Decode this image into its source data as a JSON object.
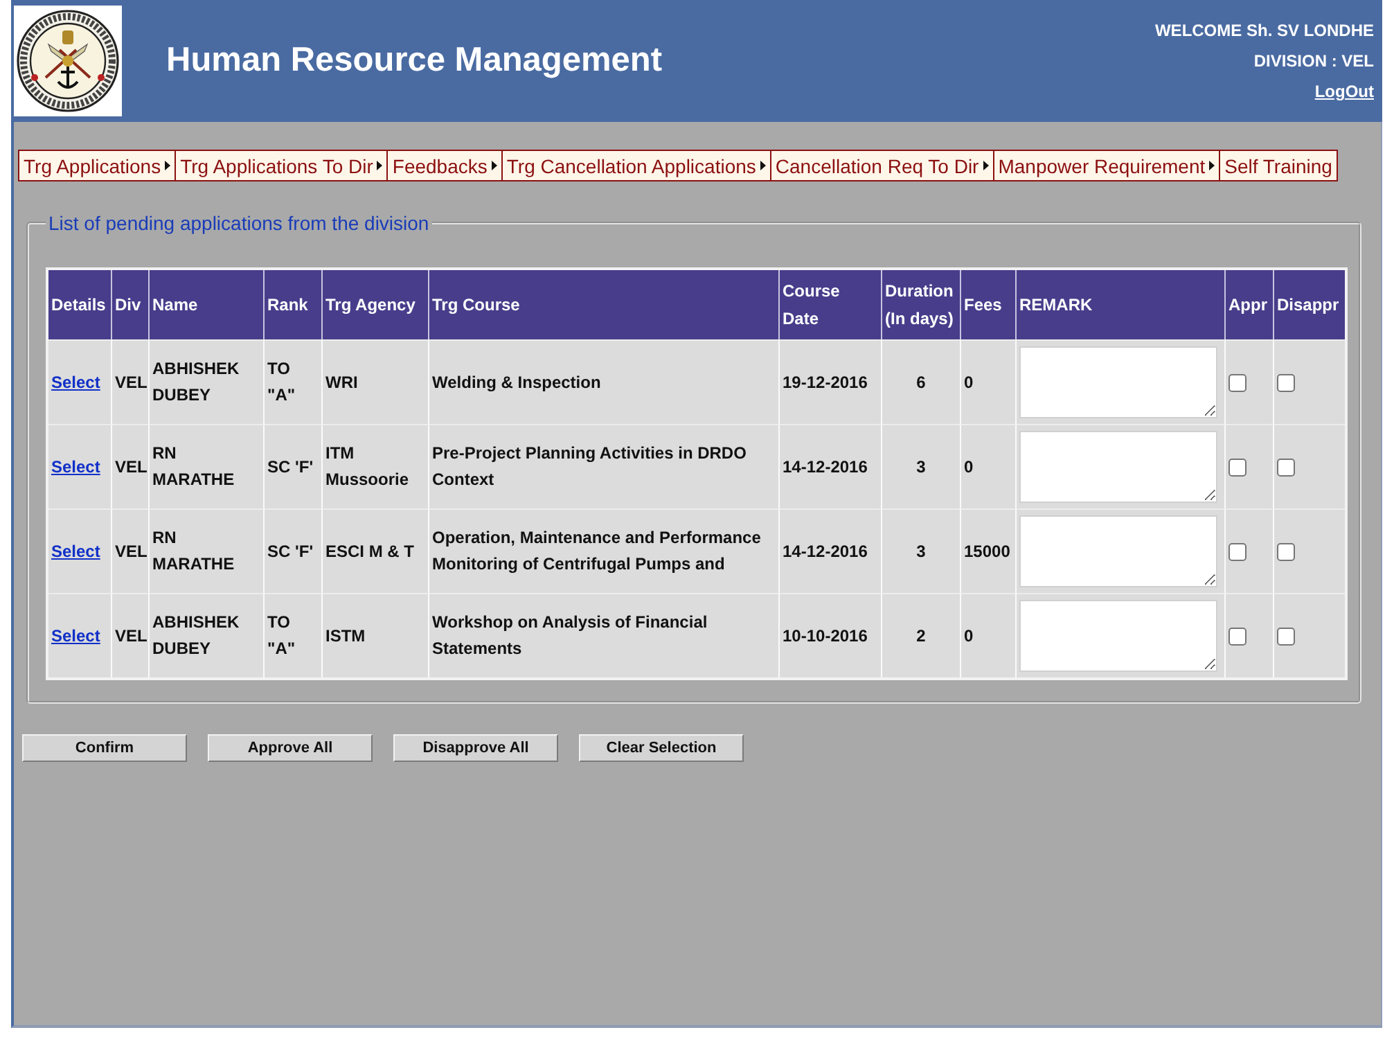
{
  "header": {
    "title": "Human Resource Management",
    "welcome": "WELCOME Sh. SV LONDHE",
    "division": "DIVISION : VEL",
    "logout": "LogOut"
  },
  "menu": [
    {
      "label": "Trg Applications",
      "submenu": true
    },
    {
      "label": "Trg Applications To Dir",
      "submenu": true
    },
    {
      "label": "Feedbacks",
      "submenu": true
    },
    {
      "label": "Trg Cancellation Applications",
      "submenu": true
    },
    {
      "label": "Cancellation Req To Dir",
      "submenu": true
    },
    {
      "label": "Manpower Requirement",
      "submenu": true
    },
    {
      "label": "Self Training",
      "submenu": false
    }
  ],
  "pending": {
    "legend": "List of pending applications from the division",
    "columns": [
      "Details",
      "Div",
      "Name",
      "Rank",
      "Trg Agency",
      "Trg Course",
      "Course Date",
      "Duration (In days)",
      "Fees",
      "REMARK",
      "Appr",
      "Disappr"
    ],
    "rows": [
      {
        "details": "Select",
        "div": "VEL",
        "name": "ABHISHEK DUBEY",
        "rank": "TO \"A\"",
        "agency": "WRI",
        "course": "Welding & Inspection",
        "date": "19-12-2016",
        "duration": "6",
        "fees": "0",
        "approved": false,
        "disapproved": false
      },
      {
        "details": "Select",
        "div": "VEL",
        "name": "RN MARATHE",
        "rank": "SC 'F'",
        "agency": "ITM Mussoorie",
        "course": "Pre-Project Planning Activities in DRDO Context",
        "date": "14-12-2016",
        "duration": "3",
        "fees": "0",
        "approved": false,
        "disapproved": false
      },
      {
        "details": "Select",
        "div": "VEL",
        "name": "RN MARATHE",
        "rank": "SC 'F'",
        "agency": "ESCI M & T",
        "course": "Operation, Maintenance and Performance Monitoring of Centrifugal Pumps and",
        "date": "14-12-2016",
        "duration": "3",
        "fees": "15000",
        "approved": false,
        "disapproved": false
      },
      {
        "details": "Select",
        "div": "VEL",
        "name": "ABHISHEK DUBEY",
        "rank": "TO \"A\"",
        "agency": "ISTM",
        "course": "Workshop on Analysis of Financial Statements",
        "date": "10-10-2016",
        "duration": "2",
        "fees": "0",
        "approved": false,
        "disapproved": false
      }
    ]
  },
  "buttons": [
    "Confirm",
    "Approve All",
    "Disapprove All",
    "Clear Selection"
  ]
}
